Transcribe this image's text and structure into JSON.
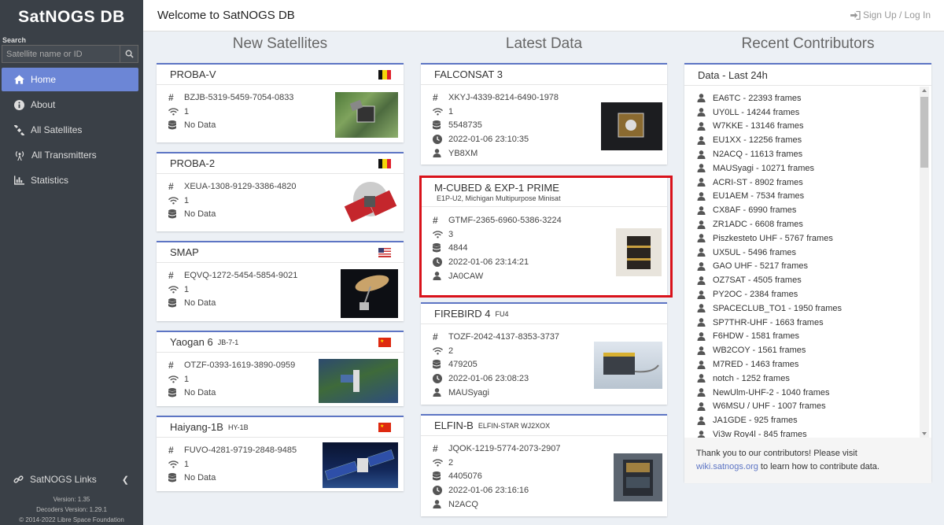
{
  "sidebar": {
    "brand": "SatNOGS DB",
    "search_label": "Search",
    "search_placeholder": "Satellite name or ID",
    "items": [
      {
        "label": "Home",
        "icon": "home-icon",
        "active": true
      },
      {
        "label": "About",
        "icon": "info-icon",
        "active": false
      },
      {
        "label": "All Satellites",
        "icon": "satellite-icon",
        "active": false
      },
      {
        "label": "All Transmitters",
        "icon": "transmitter-icon",
        "active": false
      },
      {
        "label": "Statistics",
        "icon": "chart-icon",
        "active": false
      }
    ],
    "links_label": "SatNOGS Links",
    "version": "Version: 1.35",
    "decoders_version": "Decoders Version: 1.29.1",
    "copyright": "© 2014-2022 Libre Space Foundation"
  },
  "header": {
    "title": "Welcome to SatNOGS DB",
    "auth": "Sign Up / Log In"
  },
  "columns": {
    "new_satellites": "New Satellites",
    "latest_data": "Latest Data",
    "recent_contributors": "Recent Contributors"
  },
  "new_satellites": [
    {
      "name": "PROBA-V",
      "alt": "",
      "id": "BZJB-5319-5459-7054-0833",
      "transmitters": "1",
      "frames": "No Data",
      "flag": "be"
    },
    {
      "name": "PROBA-2",
      "alt": "",
      "id": "XEUA-1308-9129-3386-4820",
      "transmitters": "1",
      "frames": "No Data",
      "flag": "be"
    },
    {
      "name": "SMAP",
      "alt": "",
      "id": "EQVQ-1272-5454-5854-9021",
      "transmitters": "1",
      "frames": "No Data",
      "flag": "us"
    },
    {
      "name": "Yaogan 6",
      "alt": "JB-7-1",
      "id": "OTZF-0393-1619-3890-0959",
      "transmitters": "1",
      "frames": "No Data",
      "flag": "cn"
    },
    {
      "name": "Haiyang-1B",
      "alt": "HY-1B",
      "id": "FUVO-4281-9719-2848-9485",
      "transmitters": "1",
      "frames": "No Data",
      "flag": "cn"
    }
  ],
  "latest_data": [
    {
      "name": "FALCONSAT 3",
      "alt": "",
      "sub": "",
      "id": "XKYJ-4339-8214-6490-1978",
      "transmitters": "1",
      "frames": "5548735",
      "time": "2022-01-06 23:10:35",
      "contributor": "YB8XM"
    },
    {
      "name": "M-CUBED & EXP-1 PRIME",
      "alt": "",
      "sub": "E1P-U2, Michigan Multipurpose Minisat",
      "id": "GTMF-2365-6960-5386-3224",
      "transmitters": "3",
      "frames": "4844",
      "time": "2022-01-06 23:14:21",
      "contributor": "JA0CAW"
    },
    {
      "name": "FIREBIRD 4",
      "alt": "FU4",
      "sub": "",
      "id": "TOZF-2042-4137-8353-3737",
      "transmitters": "2",
      "frames": "479205",
      "time": "2022-01-06 23:08:23",
      "contributor": "MAUSyagi"
    },
    {
      "name": "ELFIN-B",
      "alt": "ELFIN-STAR WJ2XOX",
      "sub": "",
      "id": "JQOK-1219-5774-2073-2907",
      "transmitters": "2",
      "frames": "4405076",
      "time": "2022-01-06 23:16:16",
      "contributor": "N2ACQ"
    }
  ],
  "contributors": {
    "heading": "Data - Last 24h",
    "items": [
      "EA6TC - 22393 frames",
      "UY0LL - 14244 frames",
      "W7KKE - 13146 frames",
      "EU1XX - 12256 frames",
      "N2ACQ - 11613 frames",
      "MAUSyagi - 10271 frames",
      "ACRI-ST - 8902 frames",
      "EU1AEM - 7534 frames",
      "CX8AF - 6990 frames",
      "ZR1ADC - 6608 frames",
      "Piszkesteto UHF - 5767 frames",
      "UX5UL - 5496 frames",
      "GAO UHF - 5217 frames",
      "OZ7SAT - 4505 frames",
      "PY2OC - 2384 frames",
      "SPACECLUB_TO1 - 1950 frames",
      "SP7THR-UHF - 1663 frames",
      "F6HDW - 1581 frames",
      "WB2COY - 1561 frames",
      "M7RED - 1463 frames",
      "notch - 1252 frames",
      "NewUlm-UHF-2 - 1040 frames",
      "W6MSU / UHF - 1007 frames",
      "JA1GDE - 925 frames",
      "Vi3w Roy4l - 845 frames"
    ],
    "footer_text": "Thank you to our contributors! Please visit",
    "footer_link": "wiki.satnogs.org",
    "footer_tail": " to learn how to contribute data."
  },
  "colors": {
    "accent": "#5d75c4",
    "sidebar": "#3a4047",
    "active": "#6c86d6",
    "highlight": "#d9121b"
  }
}
